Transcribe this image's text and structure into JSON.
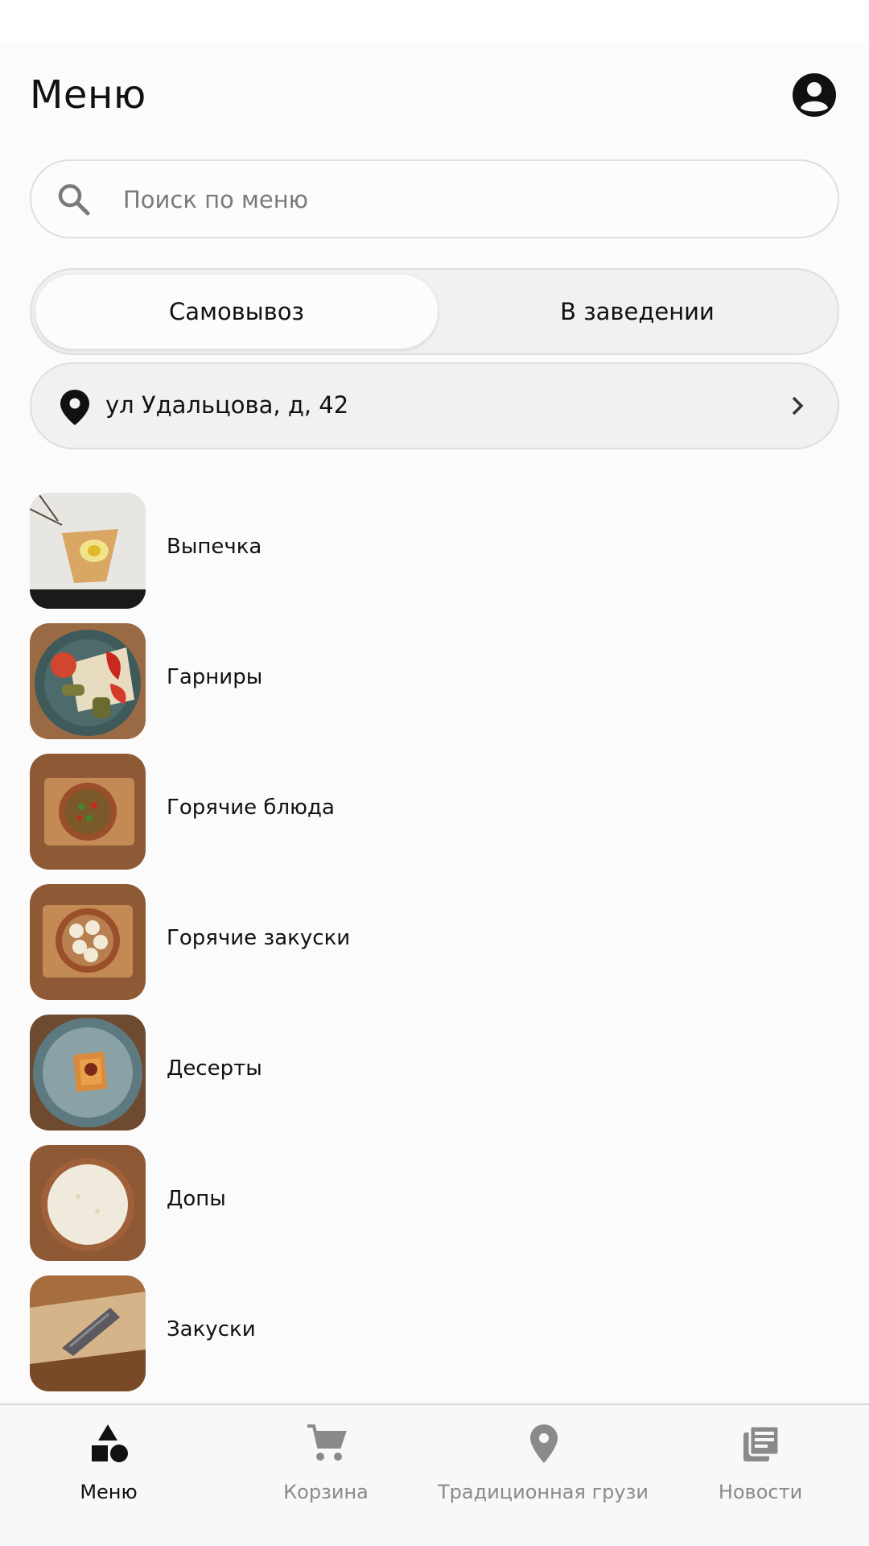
{
  "header": {
    "title": "Меню",
    "profile_icon": "account-circle-icon"
  },
  "search": {
    "placeholder": "Поиск по меню",
    "value": "",
    "icon": "search-icon"
  },
  "order_mode": {
    "options": [
      "Самовывоз",
      "В заведении"
    ],
    "selected": "Самовывоз"
  },
  "address": {
    "text": "ул Удальцова, д, 42",
    "icon": "location-pin-icon"
  },
  "categories": [
    {
      "label": "Выпечка"
    },
    {
      "label": "Гарниры"
    },
    {
      "label": "Горячие блюда"
    },
    {
      "label": "Горячие закуски"
    },
    {
      "label": "Десерты"
    },
    {
      "label": "Допы"
    },
    {
      "label": "Закуски"
    }
  ],
  "bottom_nav": {
    "items": [
      {
        "label": "Меню",
        "icon": "shapes-icon",
        "active": true
      },
      {
        "label": "Корзина",
        "icon": "cart-icon",
        "active": false
      },
      {
        "label": "Традиционная грузи",
        "icon": "location-pin-icon",
        "active": false
      },
      {
        "label": "Новости",
        "icon": "news-icon",
        "active": false
      }
    ]
  },
  "colors": {
    "background": "#fbfbfb",
    "text": "#111111",
    "inactive_text": "#8a8a8a",
    "border": "#dedede"
  }
}
